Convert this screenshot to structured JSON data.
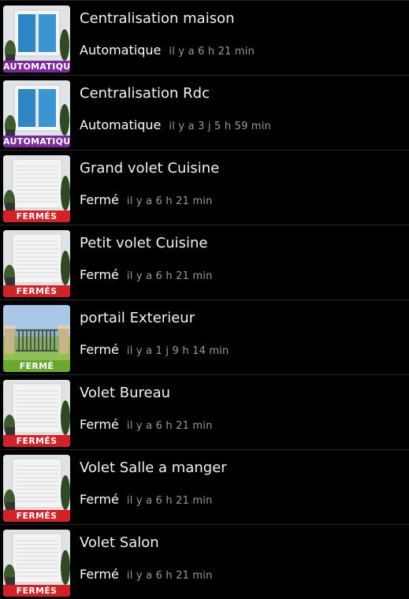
{
  "items": [
    {
      "title": "Centralisation maison",
      "status": "Automatique",
      "time": "il y a 6 h 21 min",
      "icon": "window-icon",
      "badge": "AUTOMATIQUE",
      "badge_color": "#7b2a9a"
    },
    {
      "title": "Centralisation Rdc",
      "status": "Automatique",
      "time": "il y a 3 j 5 h 59 min",
      "icon": "window-icon",
      "badge": "AUTOMATIQUE",
      "badge_color": "#7b2a9a"
    },
    {
      "title": "Grand volet Cuisine",
      "status": "Fermé",
      "time": "il y a 6 h 21 min",
      "icon": "shutter-icon",
      "badge": "FERMÉS",
      "badge_color": "#d42128"
    },
    {
      "title": "Petit volet Cuisine",
      "status": "Fermé",
      "time": "il y a 6 h 21 min",
      "icon": "shutter-icon",
      "badge": "FERMÉS",
      "badge_color": "#d42128"
    },
    {
      "title": "portail Exterieur",
      "status": "Fermé",
      "time": "il y a 1 j 9 h 14 min",
      "icon": "gate-icon",
      "badge": "FERMÉ",
      "badge_color": "#6aa832"
    },
    {
      "title": "Volet Bureau",
      "status": "Fermé",
      "time": "il y a 6 h 21 min",
      "icon": "shutter-icon",
      "badge": "FERMÉS",
      "badge_color": "#d42128"
    },
    {
      "title": "Volet Salle a manger",
      "status": "Fermé",
      "time": "il y a 6 h 21 min",
      "icon": "shutter-icon",
      "badge": "FERMÉS",
      "badge_color": "#d42128"
    },
    {
      "title": "Volet Salon",
      "status": "Fermé",
      "time": "il y a 6 h 21 min",
      "icon": "shutter-icon",
      "badge": "FERMÉS",
      "badge_color": "#d42128"
    }
  ]
}
